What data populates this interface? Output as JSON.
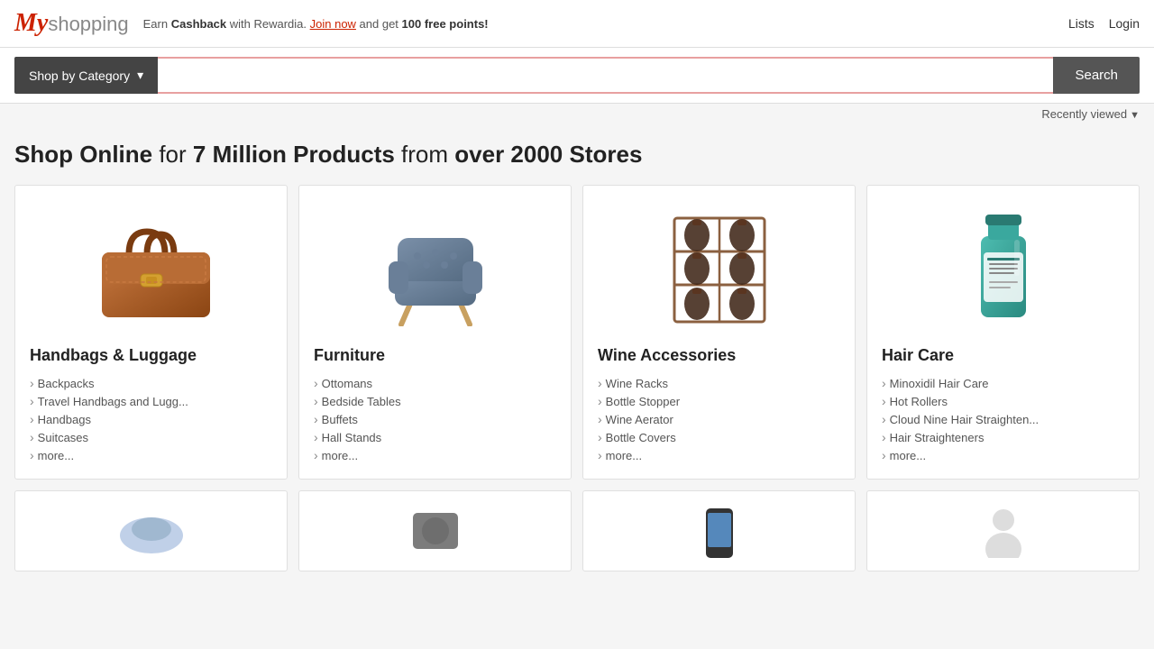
{
  "header": {
    "logo_my": "My",
    "logo_shopping": "shopping",
    "cashback_text_pre": "Earn ",
    "cashback_bold": "Cashback",
    "cashback_mid": " with Rewardia. ",
    "cashback_link": "Join now",
    "cashback_post": " and get ",
    "cashback_points_bold": "100 free points!",
    "links": [
      {
        "label": "Lists"
      },
      {
        "label": "Login"
      }
    ]
  },
  "search": {
    "shop_by_category": "Shop by Category",
    "placeholder": "",
    "button_label": "Search"
  },
  "recently_viewed": {
    "label": "Recently viewed"
  },
  "hero": {
    "text_normal1": "Shop Online",
    "text_bold1": " for ",
    "text_bold2": "7 Million Products",
    "text_normal2": " from ",
    "text_bold3": "over 2000 Stores"
  },
  "categories": [
    {
      "id": "handbags",
      "title": "Handbags & Luggage",
      "links": [
        "Backpacks",
        "Travel Handbags and Lugg...",
        "Handbags",
        "Suitcases",
        "more..."
      ]
    },
    {
      "id": "furniture",
      "title": "Furniture",
      "links": [
        "Ottomans",
        "Bedside Tables",
        "Buffets",
        "Hall Stands",
        "more..."
      ]
    },
    {
      "id": "wine",
      "title": "Wine Accessories",
      "links": [
        "Wine Racks",
        "Bottle Stopper",
        "Wine Aerator",
        "Bottle Covers",
        "more..."
      ]
    },
    {
      "id": "haircare",
      "title": "Hair Care",
      "links": [
        "Minoxidil Hair Care",
        "Hot Rollers",
        "Cloud Nine Hair Straighten...",
        "Hair Straighteners",
        "more..."
      ]
    }
  ],
  "bottom_row": [
    {
      "id": "bottom1"
    },
    {
      "id": "bottom2"
    },
    {
      "id": "bottom3"
    },
    {
      "id": "bottom4"
    }
  ]
}
